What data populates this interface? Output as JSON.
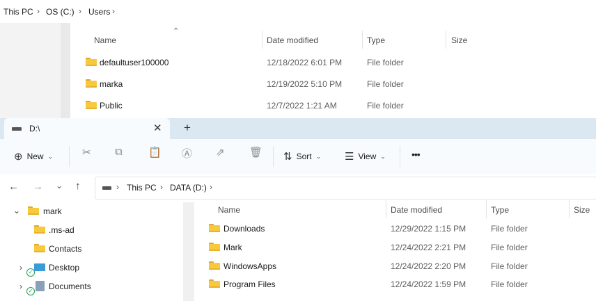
{
  "back_window": {
    "breadcrumb": [
      "This PC",
      "OS (C:)",
      "Users"
    ],
    "columns": {
      "name": "Name",
      "date": "Date modified",
      "type": "Type",
      "size": "Size"
    },
    "rows": [
      {
        "name": "defaultuser100000",
        "date": "12/18/2022 6:01 PM",
        "type": "File folder"
      },
      {
        "name": "marka",
        "date": "12/19/2022 5:10 PM",
        "type": "File folder"
      },
      {
        "name": "Public",
        "date": "12/7/2022 1:21 AM",
        "type": "File folder"
      }
    ]
  },
  "front_window": {
    "tab_title": "D:\\",
    "toolbar": {
      "new_label": "New",
      "sort_label": "Sort",
      "view_label": "View",
      "more_label": "•••"
    },
    "address": [
      "This PC",
      "DATA (D:)"
    ],
    "nav": {
      "items": [
        {
          "label": "mark"
        },
        {
          "label": ".ms-ad"
        },
        {
          "label": "Contacts"
        },
        {
          "label": "Desktop"
        },
        {
          "label": "Documents"
        }
      ]
    },
    "columns": {
      "name": "Name",
      "date": "Date modified",
      "type": "Type",
      "size": "Size"
    },
    "rows": [
      {
        "name": "Downloads",
        "date": "12/29/2022 1:15 PM",
        "type": "File folder"
      },
      {
        "name": "Mark",
        "date": "12/24/2022 2:21 PM",
        "type": "File folder"
      },
      {
        "name": "WindowsApps",
        "date": "12/24/2022 2:20 PM",
        "type": "File folder"
      },
      {
        "name": "Program Files",
        "date": "12/24/2022 1:59 PM",
        "type": "File folder"
      }
    ]
  },
  "colors": {
    "folder": "#f8c93c",
    "tabbar": "#dce8f1",
    "sync_check": "#1f9d55"
  },
  "icons": [
    "chevron-right-icon",
    "sort-up-icon",
    "folder-icon",
    "drive-icon",
    "close-icon",
    "plus-icon",
    "cut-icon",
    "copy-icon",
    "paste-icon",
    "rename-icon",
    "share-icon",
    "delete-icon",
    "sort-icon",
    "view-icon",
    "back-icon",
    "forward-icon",
    "up-icon",
    "expand-icon"
  ]
}
